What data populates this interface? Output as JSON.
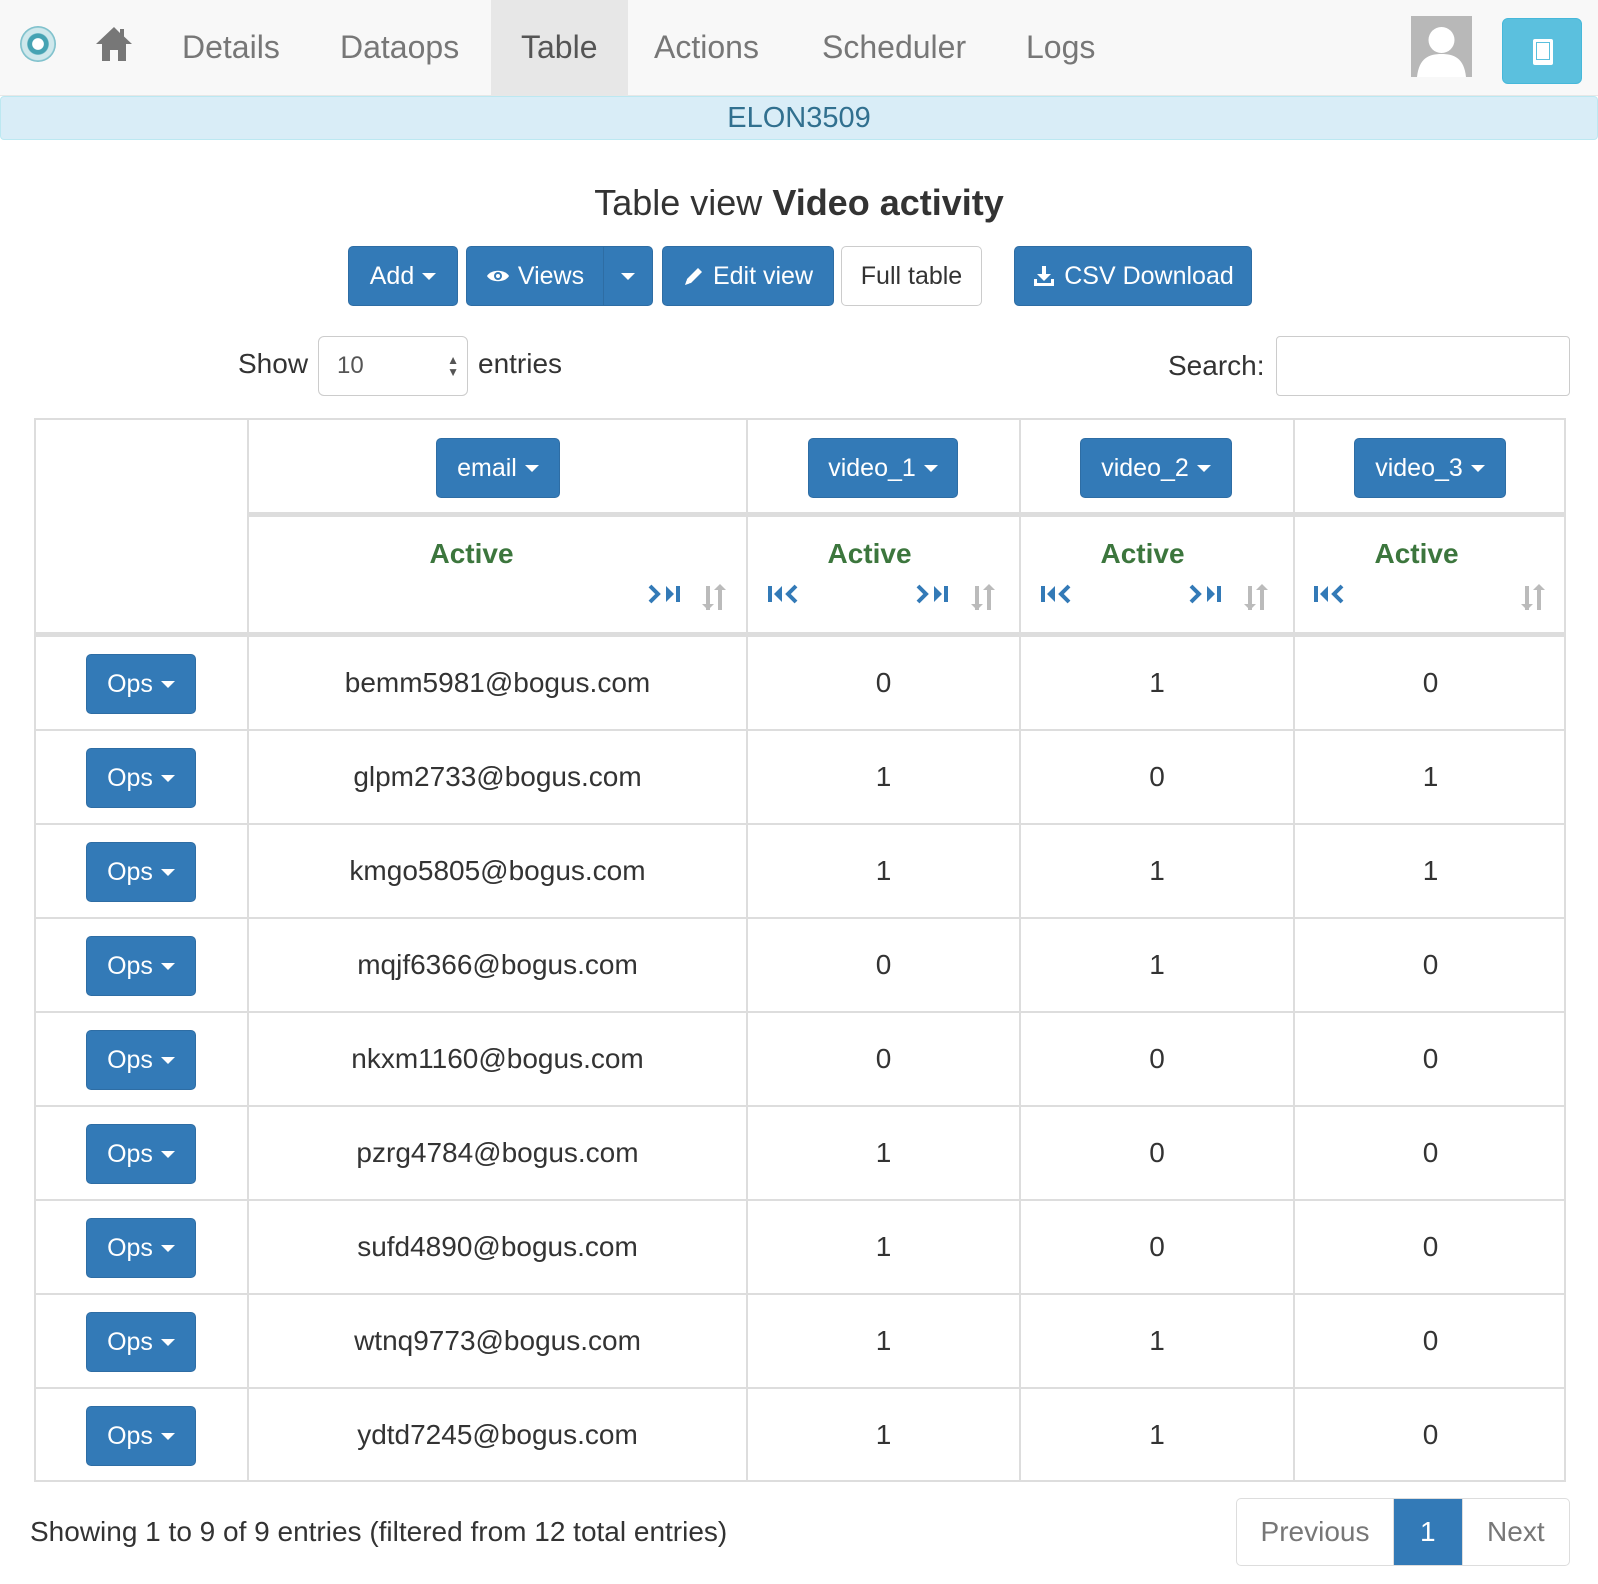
{
  "nav": {
    "items": [
      "Details",
      "Dataops",
      "Table",
      "Actions",
      "Scheduler",
      "Logs"
    ],
    "active": "Table"
  },
  "banner": {
    "text": "ELON3509"
  },
  "title": {
    "prefix": "Table view",
    "name": "Video activity"
  },
  "toolbar": {
    "add": "Add",
    "views": "Views",
    "edit_view": "Edit view",
    "full_table": "Full table",
    "csv_download": "CSV Download"
  },
  "length": {
    "show": "Show",
    "value": "10",
    "entries": "entries"
  },
  "search": {
    "label": "Search:",
    "value": ""
  },
  "table": {
    "columns": [
      "email",
      "video_1",
      "video_2",
      "video_3"
    ],
    "subheader": "Active",
    "ops_label": "Ops",
    "rows": [
      [
        "bemm5981@bogus.com",
        "0",
        "1",
        "0"
      ],
      [
        "glpm2733@bogus.com",
        "1",
        "0",
        "1"
      ],
      [
        "kmgo5805@bogus.com",
        "1",
        "1",
        "1"
      ],
      [
        "mqjf6366@bogus.com",
        "0",
        "1",
        "0"
      ],
      [
        "nkxm1160@bogus.com",
        "0",
        "0",
        "0"
      ],
      [
        "pzrg4784@bogus.com",
        "1",
        "0",
        "0"
      ],
      [
        "sufd4890@bogus.com",
        "1",
        "0",
        "0"
      ],
      [
        "wtnq9773@bogus.com",
        "1",
        "1",
        "0"
      ],
      [
        "ydtd7245@bogus.com",
        "1",
        "1",
        "0"
      ]
    ]
  },
  "footer": {
    "info": "Showing 1 to 9 of 9 entries (filtered from 12 total entries)",
    "previous": "Previous",
    "page": "1",
    "next": "Next"
  },
  "colors": {
    "primary": "#337ab7",
    "active_green": "#3c763d",
    "banner_bg": "#d9edf7",
    "banner_text": "#31708f",
    "info_btn": "#5bc0de"
  }
}
